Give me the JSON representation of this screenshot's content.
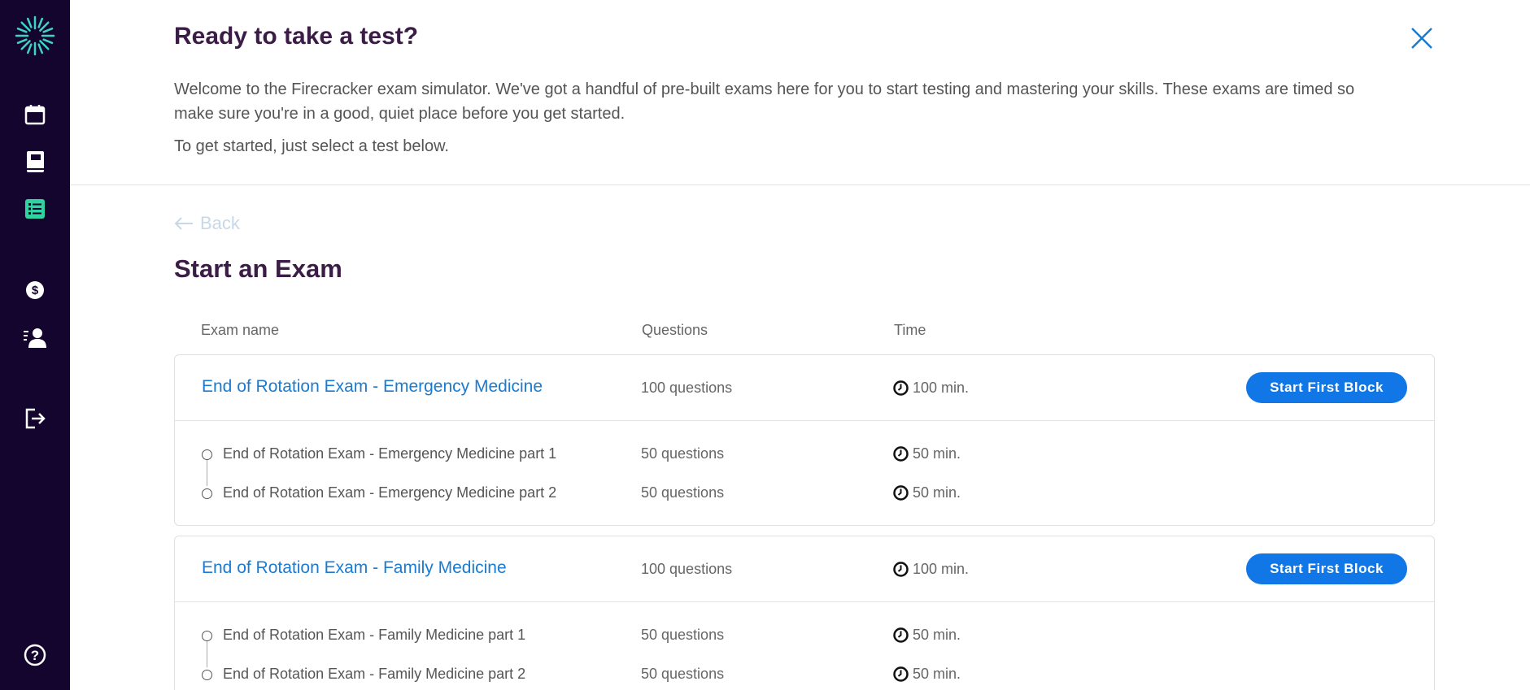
{
  "header": {
    "title": "Ready to take a test?",
    "intro_line1": "Welcome to the Firecracker exam simulator. We've got a handful of pre-built exams here for you to start testing and mastering your skills. These exams are timed so",
    "intro_line2": "make sure you're in a good, quiet place before you get started.",
    "intro_line3": "To get started, just select a test below."
  },
  "back_label": "Back",
  "section_title": "Start an Exam",
  "columns": {
    "name": "Exam name",
    "questions": "Questions",
    "time": "Time"
  },
  "exams": [
    {
      "name": "End of Rotation Exam - Emergency Medicine",
      "questions": "100 questions",
      "time": "100 min.",
      "button": "Start First Block",
      "parts": [
        {
          "name": "End of Rotation Exam - Emergency Medicine part 1",
          "questions": "50 questions",
          "time": "50 min."
        },
        {
          "name": "End of Rotation Exam - Emergency Medicine part 2",
          "questions": "50 questions",
          "time": "50 min."
        }
      ]
    },
    {
      "name": "End of Rotation Exam - Family Medicine",
      "questions": "100 questions",
      "time": "100 min.",
      "button": "Start First Block",
      "parts": [
        {
          "name": "End of Rotation Exam - Family Medicine part 1",
          "questions": "50 questions",
          "time": "50 min."
        },
        {
          "name": "End of Rotation Exam - Family Medicine part 2",
          "questions": "50 questions",
          "time": "50 min."
        }
      ]
    }
  ],
  "sidebar_icons": [
    "firecracker-logo-icon",
    "calendar-icon",
    "notebook-icon",
    "checklist-icon",
    "dollar-icon",
    "user-profile-icon",
    "logout-icon",
    "help-icon"
  ],
  "colors": {
    "sidebar_bg": "#14052e",
    "accent": "#1277e6",
    "title": "#3b1c46",
    "active_icon": "#2ed3a0"
  }
}
